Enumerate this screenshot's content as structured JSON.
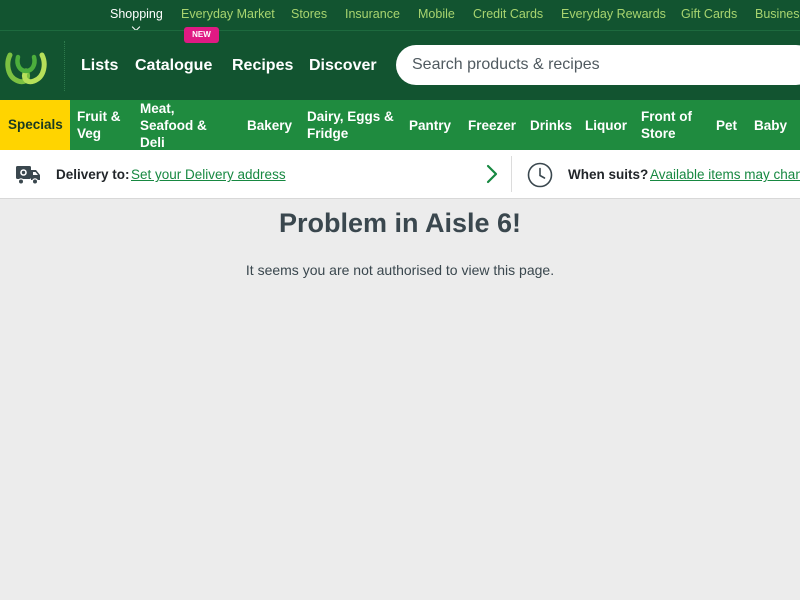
{
  "topbar": {
    "items": [
      {
        "label": "Shopping",
        "active": true
      },
      {
        "label": "Everyday Market"
      },
      {
        "label": "Stores"
      },
      {
        "label": "Insurance"
      },
      {
        "label": "Mobile"
      },
      {
        "label": "Credit Cards"
      },
      {
        "label": "Everyday Rewards"
      },
      {
        "label": "Gift Cards"
      },
      {
        "label": "Business"
      }
    ],
    "new_badge": "NEW"
  },
  "header": {
    "logo_icon": "woolworths-logo-icon",
    "nav": [
      "Lists",
      "Catalogue",
      "Recipes",
      "Discover"
    ],
    "search": {
      "placeholder": "Search products & recipes",
      "value": ""
    }
  },
  "categories": {
    "specials": "Specials",
    "items": [
      {
        "line1": "Fruit &",
        "line2": "Veg"
      },
      {
        "line1": "Meat,",
        "line2": "Seafood &",
        "line3": "Deli"
      },
      {
        "line1": "Bakery"
      },
      {
        "line1": "Dairy, Eggs &",
        "line2": "Fridge"
      },
      {
        "line1": "Pantry"
      },
      {
        "line1": "Freezer"
      },
      {
        "line1": "Drinks"
      },
      {
        "line1": "Liquor"
      },
      {
        "line1": "Front of",
        "line2": "Store"
      },
      {
        "line1": "Pet"
      },
      {
        "line1": "Baby"
      }
    ]
  },
  "delivery": {
    "icon": "delivery-truck-icon",
    "label": "Delivery to:",
    "link": "Set your Delivery address",
    "time_icon": "clock-icon",
    "time_label": "When suits?",
    "time_link": "Available items may change"
  },
  "error": {
    "title": "Problem in Aisle 6!",
    "message": "It seems you are not authorised to view this page."
  },
  "colors": {
    "header_green": "#125430",
    "category_green": "#1f8b3f",
    "specials_yellow": "#ffd400",
    "link_green": "#178841",
    "badge_pink": "#e01a83",
    "page_bg": "#ececec"
  }
}
